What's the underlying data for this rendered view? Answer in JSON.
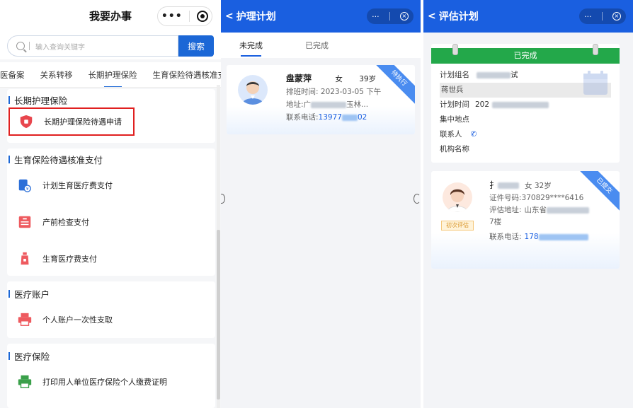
{
  "panel1": {
    "title": "我要办事",
    "capsule_more": "•••",
    "search_placeholder": "输入查询关键字",
    "search_button": "搜索",
    "tabs": [
      "医备案",
      "关系转移",
      "长期护理保险",
      "生育保险待遇核准支"
    ],
    "active_tab_index": 2,
    "sections": [
      {
        "title": "长期护理保险",
        "items": [
          {
            "label": "长期护理保险待遇申请",
            "icon": "shield-icon",
            "highlighted": true
          }
        ]
      },
      {
        "title": "生育保险待遇核准支付",
        "items": [
          {
            "label": "计划生育医疗费支付",
            "icon": "payment-icon"
          },
          {
            "label": "产前检查支付",
            "icon": "prenatal-check-icon"
          },
          {
            "label": "生育医疗费支付",
            "icon": "bottle-icon"
          }
        ]
      },
      {
        "title": "医疗账户",
        "items": [
          {
            "label": "个人账户一次性支取",
            "icon": "printer-icon"
          }
        ]
      },
      {
        "title": "医疗保险",
        "items": [
          {
            "label": "打印用人单位医疗保险个人缴费证明",
            "icon": "printer-green-icon"
          }
        ]
      }
    ],
    "colors": {
      "accent": "#1b67d6",
      "highlight": "#e02020"
    }
  },
  "panel2": {
    "title": "护理计划",
    "capsule_more": "···",
    "capsule_close": "×",
    "tabs": [
      "未完成",
      "已完成"
    ],
    "active_tab_index": 0,
    "card": {
      "badge": "待执行",
      "name": "盘蒙萍",
      "gender": "女",
      "age": "39岁",
      "schedule_label": "排班时间:",
      "schedule_value": "2023-03-05 下午",
      "address_label": "地址:",
      "address_prefix": "广",
      "address_suffix": "玉林...",
      "phone_label": "联系电话:",
      "phone_prefix": "13977",
      "phone_suffix": "02"
    },
    "colors": {
      "header": "#1a5fe0"
    }
  },
  "panel3": {
    "title": "评估计划",
    "capsule_more": "···",
    "capsule_close": "×",
    "card1": {
      "status": "已完成",
      "group_label": "计划组名",
      "group_suffix": "试",
      "person": "蒋世兵",
      "time_label": "计划时间",
      "time_prefix": "202",
      "location_label": "集中地点",
      "contact_label": "联系人",
      "org_label": "机构名称"
    },
    "card2": {
      "badge": "已提交",
      "name_prefix": "扌",
      "gender_age": "女  32岁",
      "id_label": "证件号码:",
      "id_value": "370829****6416",
      "addr_label": "评估地址:",
      "addr_prefix": "山东省",
      "addr_line2": "7楼",
      "phone_label": "联系电话:",
      "phone_prefix": "178",
      "tag": "初次评估"
    },
    "colors": {
      "status": "#23a84a"
    }
  }
}
